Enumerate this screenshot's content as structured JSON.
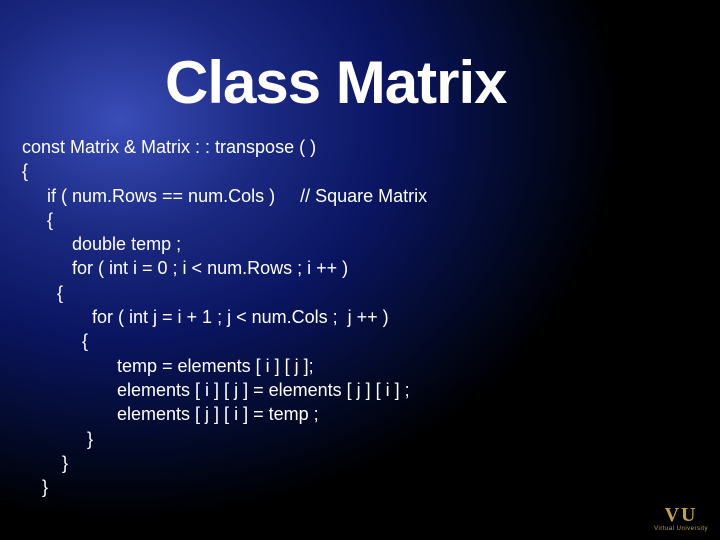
{
  "title": "Class Matrix",
  "code": {
    "l1": "const Matrix & Matrix : : transpose ( )",
    "l2": "{",
    "l3": "     if ( num.Rows == num.Cols )     // Square Matrix",
    "l4": "     {",
    "l5": "          double temp ;",
    "l6": "          for ( int i = 0 ; i < num.Rows ; i ++ )",
    "l7": "       {",
    "l8": "              for ( int j = i + 1 ; j < num.Cols ;  j ++ )",
    "l9": "            {",
    "l10": "                   temp = elements [ i ] [ j ];",
    "l11": "                   elements [ i ] [ j ] = elements [ j ] [ i ] ;",
    "l12": "                   elements [ j ] [ i ] = temp ;",
    "l13": "             }",
    "l14": "        }",
    "l15": "    }"
  },
  "logo": {
    "main": "VU",
    "sub": "Virtual University"
  }
}
